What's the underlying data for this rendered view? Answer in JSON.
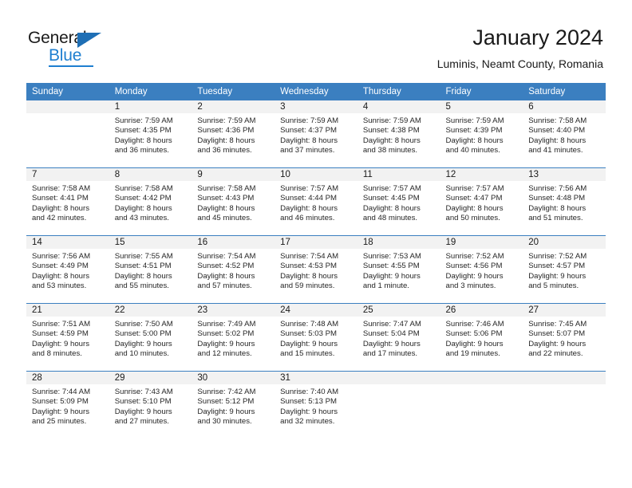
{
  "brand": {
    "name_primary": "General",
    "name_secondary": "Blue"
  },
  "header": {
    "title": "January 2024",
    "subtitle": "Luminis, Neamt County, Romania"
  },
  "colors": {
    "header_blue": "#3b7fc0",
    "logo_blue": "#1f7fd0",
    "daynum_band": "#f2f2f2"
  },
  "weekday_headers": [
    "Sunday",
    "Monday",
    "Tuesday",
    "Wednesday",
    "Thursday",
    "Friday",
    "Saturday"
  ],
  "weeks": [
    [
      {
        "day": "",
        "empty": true,
        "sunrise": "",
        "sunset": "",
        "daylight_line1": "",
        "daylight_line2": ""
      },
      {
        "day": "1",
        "sunrise": "Sunrise: 7:59 AM",
        "sunset": "Sunset: 4:35 PM",
        "daylight_line1": "Daylight: 8 hours",
        "daylight_line2": "and 36 minutes."
      },
      {
        "day": "2",
        "sunrise": "Sunrise: 7:59 AM",
        "sunset": "Sunset: 4:36 PM",
        "daylight_line1": "Daylight: 8 hours",
        "daylight_line2": "and 36 minutes."
      },
      {
        "day": "3",
        "sunrise": "Sunrise: 7:59 AM",
        "sunset": "Sunset: 4:37 PM",
        "daylight_line1": "Daylight: 8 hours",
        "daylight_line2": "and 37 minutes."
      },
      {
        "day": "4",
        "sunrise": "Sunrise: 7:59 AM",
        "sunset": "Sunset: 4:38 PM",
        "daylight_line1": "Daylight: 8 hours",
        "daylight_line2": "and 38 minutes."
      },
      {
        "day": "5",
        "sunrise": "Sunrise: 7:59 AM",
        "sunset": "Sunset: 4:39 PM",
        "daylight_line1": "Daylight: 8 hours",
        "daylight_line2": "and 40 minutes."
      },
      {
        "day": "6",
        "sunrise": "Sunrise: 7:58 AM",
        "sunset": "Sunset: 4:40 PM",
        "daylight_line1": "Daylight: 8 hours",
        "daylight_line2": "and 41 minutes."
      }
    ],
    [
      {
        "day": "7",
        "sunrise": "Sunrise: 7:58 AM",
        "sunset": "Sunset: 4:41 PM",
        "daylight_line1": "Daylight: 8 hours",
        "daylight_line2": "and 42 minutes."
      },
      {
        "day": "8",
        "sunrise": "Sunrise: 7:58 AM",
        "sunset": "Sunset: 4:42 PM",
        "daylight_line1": "Daylight: 8 hours",
        "daylight_line2": "and 43 minutes."
      },
      {
        "day": "9",
        "sunrise": "Sunrise: 7:58 AM",
        "sunset": "Sunset: 4:43 PM",
        "daylight_line1": "Daylight: 8 hours",
        "daylight_line2": "and 45 minutes."
      },
      {
        "day": "10",
        "sunrise": "Sunrise: 7:57 AM",
        "sunset": "Sunset: 4:44 PM",
        "daylight_line1": "Daylight: 8 hours",
        "daylight_line2": "and 46 minutes."
      },
      {
        "day": "11",
        "sunrise": "Sunrise: 7:57 AM",
        "sunset": "Sunset: 4:45 PM",
        "daylight_line1": "Daylight: 8 hours",
        "daylight_line2": "and 48 minutes."
      },
      {
        "day": "12",
        "sunrise": "Sunrise: 7:57 AM",
        "sunset": "Sunset: 4:47 PM",
        "daylight_line1": "Daylight: 8 hours",
        "daylight_line2": "and 50 minutes."
      },
      {
        "day": "13",
        "sunrise": "Sunrise: 7:56 AM",
        "sunset": "Sunset: 4:48 PM",
        "daylight_line1": "Daylight: 8 hours",
        "daylight_line2": "and 51 minutes."
      }
    ],
    [
      {
        "day": "14",
        "sunrise": "Sunrise: 7:56 AM",
        "sunset": "Sunset: 4:49 PM",
        "daylight_line1": "Daylight: 8 hours",
        "daylight_line2": "and 53 minutes."
      },
      {
        "day": "15",
        "sunrise": "Sunrise: 7:55 AM",
        "sunset": "Sunset: 4:51 PM",
        "daylight_line1": "Daylight: 8 hours",
        "daylight_line2": "and 55 minutes."
      },
      {
        "day": "16",
        "sunrise": "Sunrise: 7:54 AM",
        "sunset": "Sunset: 4:52 PM",
        "daylight_line1": "Daylight: 8 hours",
        "daylight_line2": "and 57 minutes."
      },
      {
        "day": "17",
        "sunrise": "Sunrise: 7:54 AM",
        "sunset": "Sunset: 4:53 PM",
        "daylight_line1": "Daylight: 8 hours",
        "daylight_line2": "and 59 minutes."
      },
      {
        "day": "18",
        "sunrise": "Sunrise: 7:53 AM",
        "sunset": "Sunset: 4:55 PM",
        "daylight_line1": "Daylight: 9 hours",
        "daylight_line2": "and 1 minute."
      },
      {
        "day": "19",
        "sunrise": "Sunrise: 7:52 AM",
        "sunset": "Sunset: 4:56 PM",
        "daylight_line1": "Daylight: 9 hours",
        "daylight_line2": "and 3 minutes."
      },
      {
        "day": "20",
        "sunrise": "Sunrise: 7:52 AM",
        "sunset": "Sunset: 4:57 PM",
        "daylight_line1": "Daylight: 9 hours",
        "daylight_line2": "and 5 minutes."
      }
    ],
    [
      {
        "day": "21",
        "sunrise": "Sunrise: 7:51 AM",
        "sunset": "Sunset: 4:59 PM",
        "daylight_line1": "Daylight: 9 hours",
        "daylight_line2": "and 8 minutes."
      },
      {
        "day": "22",
        "sunrise": "Sunrise: 7:50 AM",
        "sunset": "Sunset: 5:00 PM",
        "daylight_line1": "Daylight: 9 hours",
        "daylight_line2": "and 10 minutes."
      },
      {
        "day": "23",
        "sunrise": "Sunrise: 7:49 AM",
        "sunset": "Sunset: 5:02 PM",
        "daylight_line1": "Daylight: 9 hours",
        "daylight_line2": "and 12 minutes."
      },
      {
        "day": "24",
        "sunrise": "Sunrise: 7:48 AM",
        "sunset": "Sunset: 5:03 PM",
        "daylight_line1": "Daylight: 9 hours",
        "daylight_line2": "and 15 minutes."
      },
      {
        "day": "25",
        "sunrise": "Sunrise: 7:47 AM",
        "sunset": "Sunset: 5:04 PM",
        "daylight_line1": "Daylight: 9 hours",
        "daylight_line2": "and 17 minutes."
      },
      {
        "day": "26",
        "sunrise": "Sunrise: 7:46 AM",
        "sunset": "Sunset: 5:06 PM",
        "daylight_line1": "Daylight: 9 hours",
        "daylight_line2": "and 19 minutes."
      },
      {
        "day": "27",
        "sunrise": "Sunrise: 7:45 AM",
        "sunset": "Sunset: 5:07 PM",
        "daylight_line1": "Daylight: 9 hours",
        "daylight_line2": "and 22 minutes."
      }
    ],
    [
      {
        "day": "28",
        "sunrise": "Sunrise: 7:44 AM",
        "sunset": "Sunset: 5:09 PM",
        "daylight_line1": "Daylight: 9 hours",
        "daylight_line2": "and 25 minutes."
      },
      {
        "day": "29",
        "sunrise": "Sunrise: 7:43 AM",
        "sunset": "Sunset: 5:10 PM",
        "daylight_line1": "Daylight: 9 hours",
        "daylight_line2": "and 27 minutes."
      },
      {
        "day": "30",
        "sunrise": "Sunrise: 7:42 AM",
        "sunset": "Sunset: 5:12 PM",
        "daylight_line1": "Daylight: 9 hours",
        "daylight_line2": "and 30 minutes."
      },
      {
        "day": "31",
        "sunrise": "Sunrise: 7:40 AM",
        "sunset": "Sunset: 5:13 PM",
        "daylight_line1": "Daylight: 9 hours",
        "daylight_line2": "and 32 minutes."
      },
      {
        "day": "",
        "empty": true,
        "sunrise": "",
        "sunset": "",
        "daylight_line1": "",
        "daylight_line2": ""
      },
      {
        "day": "",
        "empty": true,
        "sunrise": "",
        "sunset": "",
        "daylight_line1": "",
        "daylight_line2": ""
      },
      {
        "day": "",
        "empty": true,
        "sunrise": "",
        "sunset": "",
        "daylight_line1": "",
        "daylight_line2": ""
      }
    ]
  ]
}
